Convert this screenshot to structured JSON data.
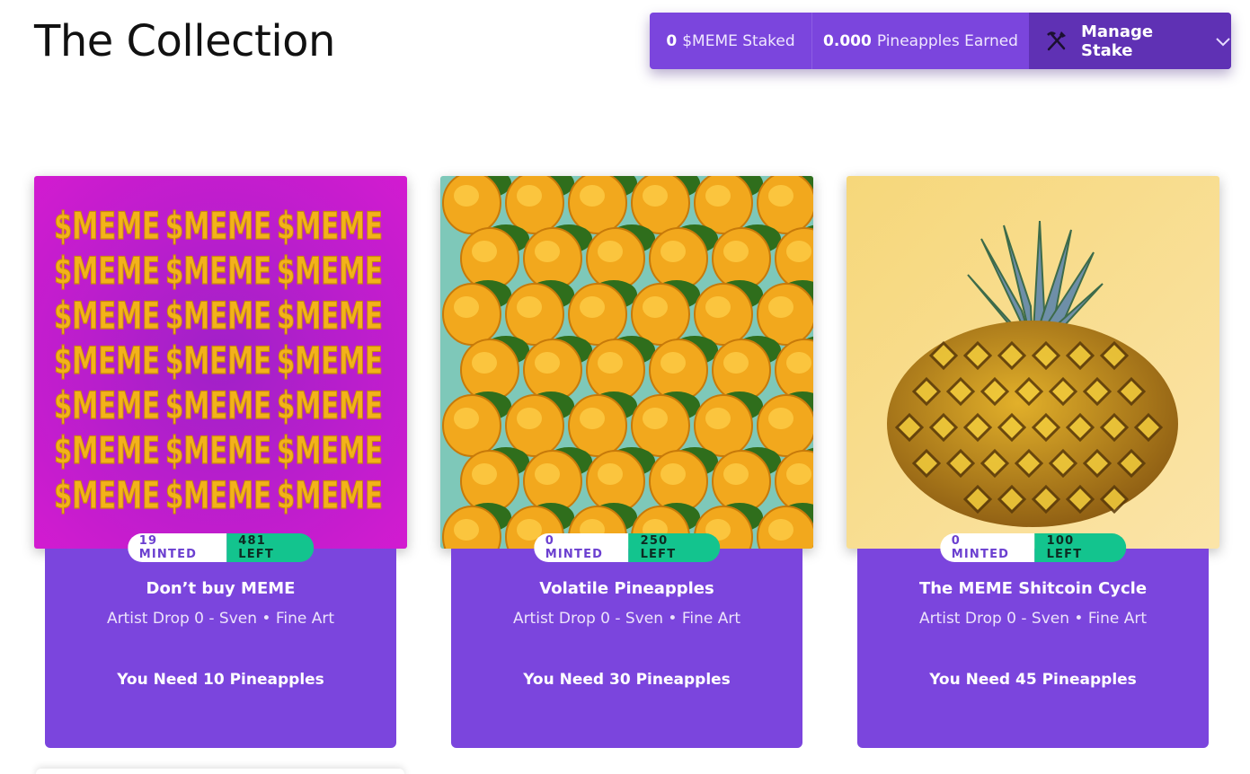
{
  "page": {
    "title": "The Collection"
  },
  "stake_bar": {
    "staked_value": "0",
    "staked_label": "$MEME Staked",
    "earned_value": "0.000",
    "earned_label": "Pineapples Earned",
    "manage_label": "Manage Stake",
    "manage_icon": "pickaxe-shovel-icon",
    "dropdown_icon": "chevron-down-icon"
  },
  "colors": {
    "accent": "#7b45dd",
    "accent_dark": "#5f31b4",
    "badge_green": "#13c48e"
  },
  "cards": [
    {
      "name": "Don’t buy MEME",
      "meta": "Artist Drop 0 - Sven • Fine Art",
      "need": "You Need 10 Pineapples",
      "minted": "19 MINTED",
      "left": "481 LEFT",
      "art_words": "$MEME"
    },
    {
      "name": "Volatile Pineapples",
      "meta": "Artist Drop 0 - Sven • Fine Art",
      "need": "You Need 30 Pineapples",
      "minted": "0 MINTED",
      "left": "250 LEFT"
    },
    {
      "name": "The MEME Shitcoin Cycle",
      "meta": "Artist Drop 0 - Sven • Fine Art",
      "need": "You Need 45 Pineapples",
      "minted": "0 MINTED",
      "left": "100 LEFT"
    }
  ]
}
